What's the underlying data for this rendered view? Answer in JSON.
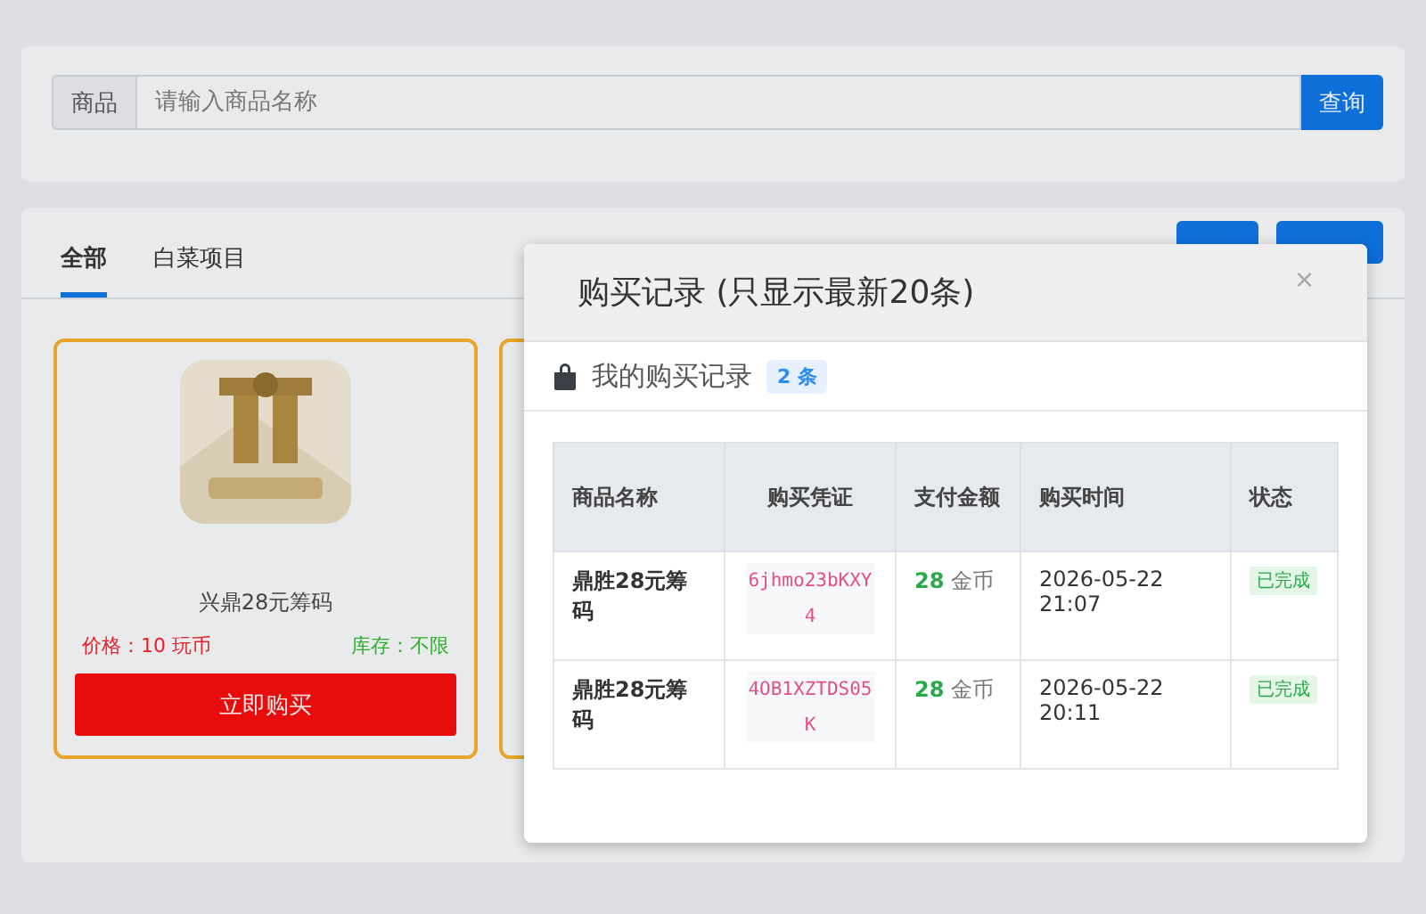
{
  "search": {
    "label": "商品",
    "placeholder": "请输入商品名称",
    "button": "查询"
  },
  "tabs": [
    {
      "label": "全部",
      "selected": true
    },
    {
      "label": "白菜项目",
      "selected": false
    }
  ],
  "products": [
    {
      "name": "兴鼎28元筹码",
      "price": "价格：10 玩币",
      "stock": "库存：不限",
      "buy_button": "立即购买"
    }
  ],
  "modal": {
    "title": "购买记录 (只显示最新20条)",
    "close": "×",
    "section_title": "我的购买记录",
    "count_badge": "2 条",
    "table": {
      "columns": [
        "商品名称",
        "购买凭证",
        "支付金额",
        "购买时间",
        "状态"
      ],
      "rows": [
        {
          "name": "鼎胜28元筹码",
          "voucher": "6jhmo23bKXY4",
          "amount": "28",
          "unit": "金币",
          "time": "2026-05-22 21:07",
          "status": "已完成"
        },
        {
          "name": "鼎胜28元筹码",
          "voucher": "4OB1XZTDS05K",
          "amount": "28",
          "unit": "金币",
          "time": "2026-05-22 20:11",
          "status": "已完成"
        }
      ]
    }
  }
}
